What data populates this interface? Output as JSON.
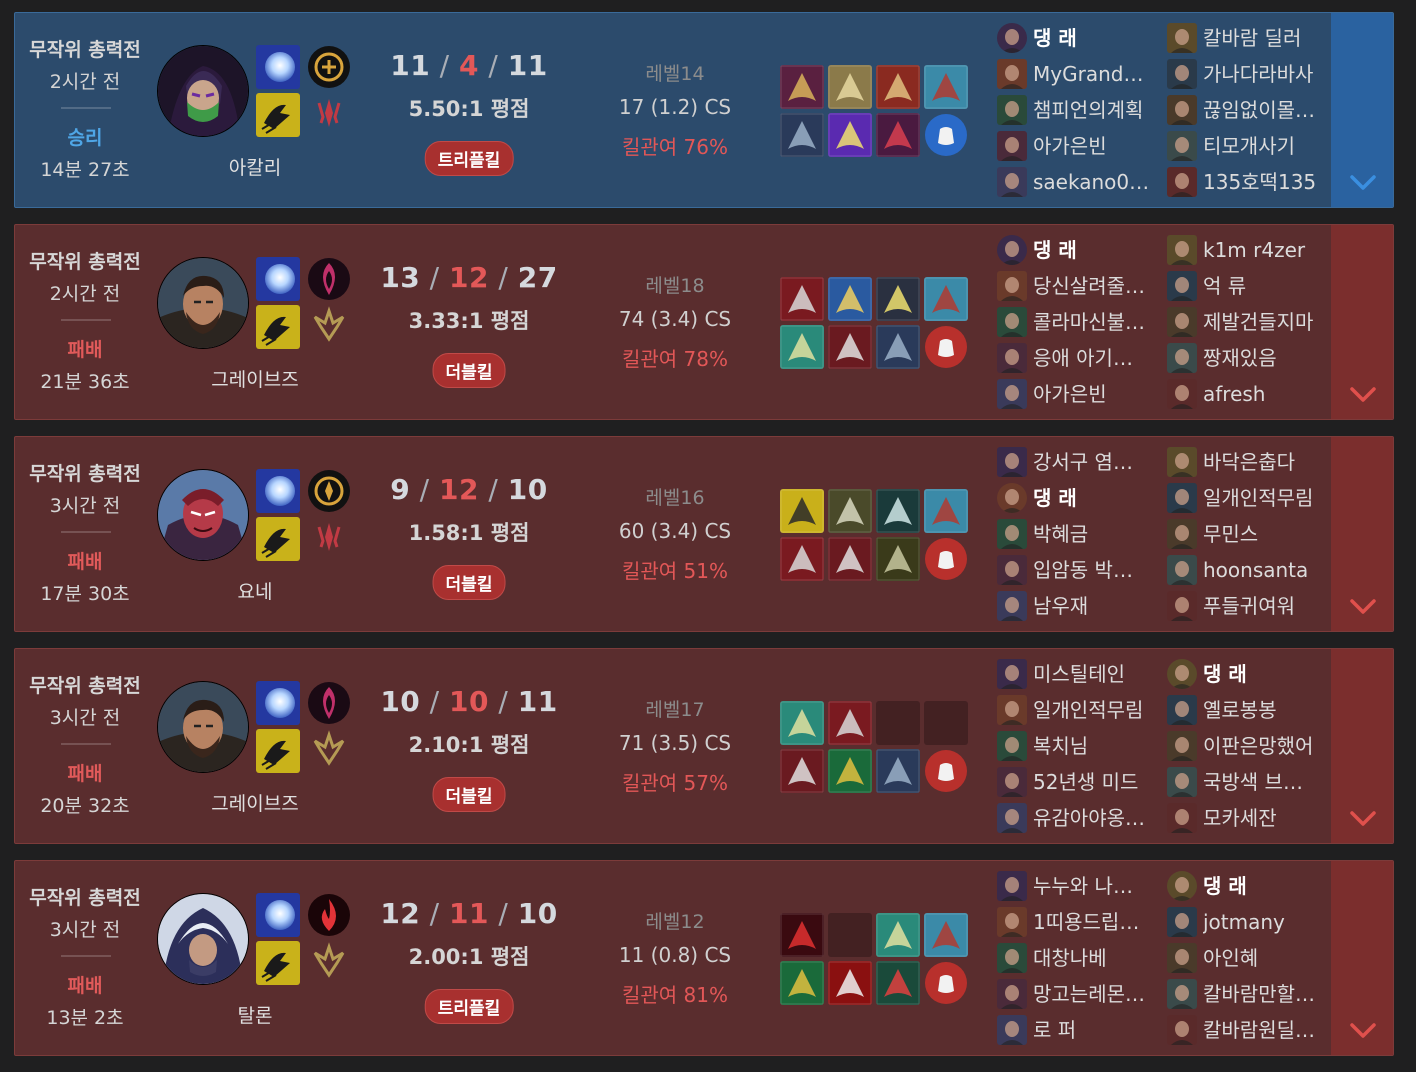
{
  "colors": {
    "win_bg": "#2c4b6c",
    "loss_bg": "#5a2d2e",
    "win_text": "#4fa6e6",
    "loss_text": "#e15a5a",
    "badge": "#a8302f"
  },
  "matches": [
    {
      "outcome": "win",
      "mode": "무작위 총력전",
      "ago": "2시간 전",
      "result": "승리",
      "duration": "14분 27초",
      "champion": "아칼리",
      "kills": "11",
      "deaths": "4",
      "assists": "11",
      "ratio": "5.50:1 평점",
      "badge": "트리플킬",
      "level": "레벨14",
      "cs": "17 (1.2) CS",
      "kp": "킬관여 76%",
      "team1": [
        "댕 래",
        "MyGrand…",
        "챔피언의계획",
        "아가은빈",
        "saekano0…"
      ],
      "team2": [
        "칼바람 딜러",
        "가나다라바사",
        "끊임없이몰…",
        "티모개사기",
        "135호떡135"
      ],
      "me_team": 1,
      "me_index": 0
    },
    {
      "outcome": "loss",
      "mode": "무작위 총력전",
      "ago": "2시간 전",
      "result": "패배",
      "duration": "21분 36초",
      "champion": "그레이브즈",
      "kills": "13",
      "deaths": "12",
      "assists": "27",
      "ratio": "3.33:1 평점",
      "badge": "더블킬",
      "level": "레벨18",
      "cs": "74 (3.4) CS",
      "kp": "킬관여 78%",
      "team1": [
        "댕 래",
        "당신살려줄…",
        "콜라마신불…",
        "응애 아기…",
        "아가은빈"
      ],
      "team2": [
        "k1m r4zer",
        "억 류",
        "제발건들지마",
        "짱재있음",
        "afresh"
      ],
      "me_team": 1,
      "me_index": 0
    },
    {
      "outcome": "loss",
      "mode": "무작위 총력전",
      "ago": "3시간 전",
      "result": "패배",
      "duration": "17분 30초",
      "champion": "요네",
      "kills": "9",
      "deaths": "12",
      "assists": "10",
      "ratio": "1.58:1 평점",
      "badge": "더블킬",
      "level": "레벨16",
      "cs": "60 (3.4) CS",
      "kp": "킬관여 51%",
      "team1": [
        "강서구 염…",
        "댕 래",
        "박혜금",
        "입암동 박…",
        "남우재"
      ],
      "team2": [
        "바닥은춥다",
        "일개인적무림",
        "무민스",
        "hoonsanta",
        "푸들귀여워"
      ],
      "me_team": 1,
      "me_index": 1
    },
    {
      "outcome": "loss",
      "mode": "무작위 총력전",
      "ago": "3시간 전",
      "result": "패배",
      "duration": "20분 32초",
      "champion": "그레이브즈",
      "kills": "10",
      "deaths": "10",
      "assists": "11",
      "ratio": "2.10:1 평점",
      "badge": "더블킬",
      "level": "레벨17",
      "cs": "71 (3.5) CS",
      "kp": "킬관여 57%",
      "team1": [
        "미스틸테인",
        "일개인적무림",
        "복치님",
        "52년생 미드",
        "유감아야옹…"
      ],
      "team2": [
        "댕 래",
        "옐로봉봉",
        "이판은망했어",
        "국방색 브…",
        "모카세잔"
      ],
      "me_team": 2,
      "me_index": 0
    },
    {
      "outcome": "loss",
      "mode": "무작위 총력전",
      "ago": "3시간 전",
      "result": "패배",
      "duration": "13분 2초",
      "champion": "탈론",
      "kills": "12",
      "deaths": "11",
      "assists": "10",
      "ratio": "2.00:1 평점",
      "badge": "트리플킬",
      "level": "레벨12",
      "cs": "11 (0.8) CS",
      "kp": "킬관여 81%",
      "team1": [
        "누누와 나…",
        "1띠용드립…",
        "대창나베",
        "망고는레몬…",
        "로 퍼"
      ],
      "team2": [
        "댕 래",
        "jotmany",
        "아인혜",
        "칼바람만할…",
        "칼바람원딜…"
      ],
      "me_team": 2,
      "me_index": 0
    }
  ]
}
